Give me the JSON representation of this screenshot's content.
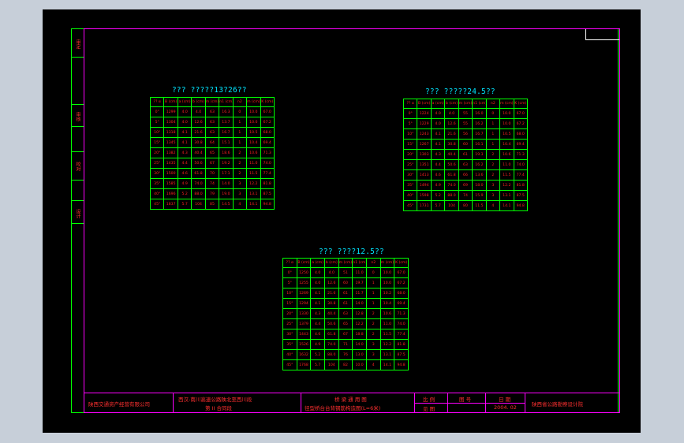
{
  "sidebar": {
    "labels": [
      "审定",
      "审核",
      "校对",
      "设计"
    ]
  },
  "tables": [
    {
      "title": "??? ?????13?26??",
      "columns": [
        "?? α",
        "B (cm)",
        "a (cm)",
        "b (cm)",
        "m (cm)",
        "n1 (cm)",
        "n2",
        "m (cm)",
        "K (cm)"
      ],
      "rows": [
        [
          "0°",
          "1299",
          "4.0",
          "4.0",
          "63",
          "16.3",
          "0",
          "10.0",
          "67.0"
        ],
        [
          "5°",
          "1304",
          "4.0",
          "12.6",
          "63",
          "13.7",
          "1",
          "10.0",
          "67.2"
        ],
        [
          "10°",
          "1318",
          "4.1",
          "21.6",
          "63",
          "16.7",
          "1",
          "10.5",
          "68.0"
        ],
        [
          "15°",
          "1345",
          "4.1",
          "30.8",
          "64",
          "15.1",
          "1",
          "10.4",
          "69.4"
        ],
        [
          "20°",
          "1382",
          "4.3",
          "40.4",
          "65",
          "18.6",
          "2",
          "10.6",
          "71.3"
        ],
        [
          "25°",
          "1435",
          "4.4",
          "50.6",
          "67",
          "19.2",
          "2",
          "11.0",
          "74.0"
        ],
        [
          "30°",
          "1500",
          "4.6",
          "61.8",
          "70",
          "17.1",
          "2",
          "11.5",
          "77.4"
        ],
        [
          "35°",
          "1585",
          "4.9",
          "74.0",
          "74",
          "14.0",
          "3",
          "12.2",
          "81.8"
        ],
        [
          "40°",
          "1696",
          "5.2",
          "88.0",
          "79",
          "19.0",
          "3",
          "13.1",
          "87.5"
        ],
        [
          "45°",
          "1837",
          "5.7",
          "104",
          "85",
          "14.5",
          "4",
          "14.1",
          "94.8"
        ]
      ]
    },
    {
      "title": "??? ?????24.5??",
      "columns": [
        "?? α",
        "B (cm)",
        "a (cm)",
        "b (cm)",
        "m (cm)",
        "n1 (cm)",
        "n2",
        "m (cm)",
        "K (cm)"
      ],
      "rows": [
        [
          "0°",
          "1224",
          "4.0",
          "4.0",
          "55",
          "16.0",
          "0",
          "10.0",
          "67.0"
        ],
        [
          "5°",
          "1229",
          "4.0",
          "12.6",
          "55",
          "16.2",
          "1",
          "10.0",
          "67.2"
        ],
        [
          "10°",
          "1243",
          "4.1",
          "21.6",
          "56",
          "16.7",
          "1",
          "10.5",
          "68.0"
        ],
        [
          "15°",
          "1267",
          "4.1",
          "30.8",
          "60",
          "16.1",
          "1",
          "10.4",
          "69.4"
        ],
        [
          "20°",
          "1303",
          "4.3",
          "40.4",
          "61",
          "19.3",
          "2",
          "10.6",
          "71.3"
        ],
        [
          "25°",
          "1351",
          "4.4",
          "50.6",
          "63",
          "16.2",
          "2",
          "11.0",
          "74.0"
        ],
        [
          "30°",
          "1413",
          "4.6",
          "61.8",
          "66",
          "13.6",
          "2",
          "11.5",
          "77.4"
        ],
        [
          "35°",
          "1494",
          "4.9",
          "74.0",
          "69",
          "18.0",
          "3",
          "12.2",
          "81.8"
        ],
        [
          "40°",
          "1598",
          "5.2",
          "88.0",
          "74",
          "15.9",
          "3",
          "13.1",
          "87.5"
        ],
        [
          "45°",
          "1731",
          "5.7",
          "104",
          "80",
          "11.5",
          "4",
          "14.1",
          "94.8"
        ]
      ]
    },
    {
      "title": "??? ????12.5??",
      "columns": [
        "?? α",
        "B (cm)",
        "a (cm)",
        "b (cm)",
        "m (cm)",
        "n1 (cm)",
        "n2",
        "m (cm)",
        "K (cm)"
      ],
      "rows": [
        [
          "0°",
          "1250",
          "4.0",
          "4.0",
          "51",
          "11.0",
          "0",
          "10.0",
          "67.0"
        ],
        [
          "5°",
          "1255",
          "4.0",
          "12.6",
          "60",
          "19.7",
          "1",
          "10.0",
          "67.2"
        ],
        [
          "10°",
          "1269",
          "4.1",
          "21.6",
          "61",
          "11.7",
          "1",
          "10.2",
          "68.0"
        ],
        [
          "15°",
          "1294",
          "4.1",
          "30.8",
          "61",
          "14.0",
          "1",
          "10.4",
          "69.4"
        ],
        [
          "20°",
          "1330",
          "4.3",
          "40.4",
          "63",
          "12.8",
          "2",
          "10.6",
          "71.3"
        ],
        [
          "25°",
          "1379",
          "4.4",
          "50.6",
          "65",
          "12.2",
          "2",
          "11.0",
          "74.0"
        ],
        [
          "30°",
          "1443",
          "4.6",
          "61.8",
          "67",
          "18.8",
          "2",
          "11.5",
          "77.4"
        ],
        [
          "35°",
          "1526",
          "4.9",
          "74.0",
          "71",
          "14.0",
          "3",
          "12.2",
          "81.8"
        ],
        [
          "40°",
          "1632",
          "5.2",
          "88.0",
          "76",
          "13.0",
          "3",
          "13.1",
          "87.5"
        ],
        [
          "45°",
          "1768",
          "5.7",
          "104",
          "82",
          "10.0",
          "4",
          "14.1",
          "94.8"
        ]
      ]
    }
  ],
  "title_block": {
    "company": "陕西交通资产经营有限公司",
    "project_line1": "西汉-南川高速公路陕北至西川段",
    "project_line2": "第 II 合同段",
    "drawing_line1": "桥 梁 通 用 图",
    "drawing_line2": "径型桥台台背钢筋构造图(L=6米)",
    "scale_label": "比 例",
    "drawing_no_label": "图 号",
    "date_label": "日 期",
    "view_label": "见 图",
    "date_value": "2004. 02",
    "designer": "陕西省公路勘察设计院"
  },
  "colors": {
    "background": "#000000",
    "frame_green": "#00ff00",
    "frame_magenta": "#ff00ff",
    "text_red": "#ff2020",
    "title_cyan": "#00e5ff",
    "app_gray": "#c7cfd9"
  }
}
